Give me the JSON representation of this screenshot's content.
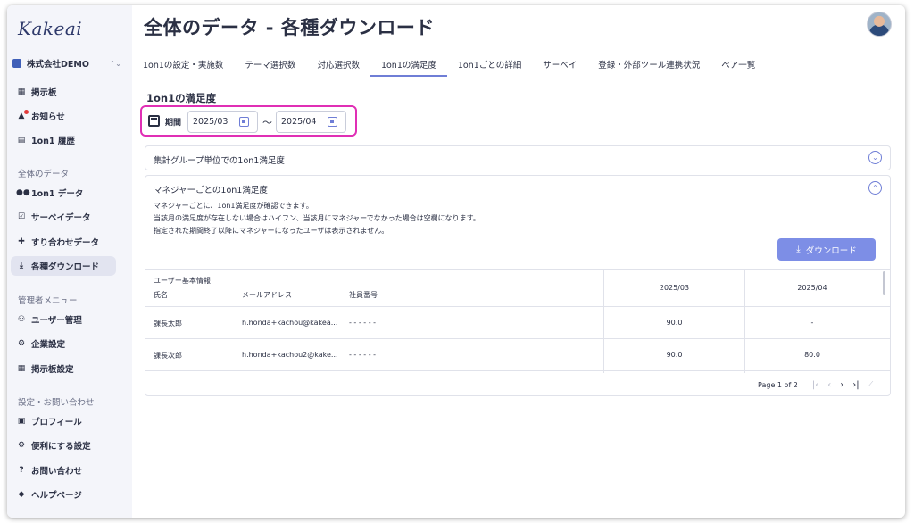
{
  "brand": {
    "logo": "Kakeai"
  },
  "company": {
    "name": "株式会社DEMO",
    "switch_icon": "⌃⌄"
  },
  "sidebar": {
    "top_items": [
      {
        "label": "掲示板",
        "icon": "board-icon"
      },
      {
        "label": "お知らせ",
        "icon": "bell-icon"
      },
      {
        "label": "1on1 履歴",
        "icon": "history-icon"
      }
    ],
    "section_data": "全体のデータ",
    "data_items": [
      {
        "label": "1on1 データ",
        "icon": "people-icon"
      },
      {
        "label": "サーベイデータ",
        "icon": "survey-icon"
      },
      {
        "label": "すり合わせデータ",
        "icon": "puzzle-icon"
      },
      {
        "label": "各種ダウンロード",
        "icon": "download-icon"
      }
    ],
    "section_admin": "管理者メニュー",
    "admin_items": [
      {
        "label": "ユーザー管理",
        "icon": "user-manage-icon"
      },
      {
        "label": "企業設定",
        "icon": "company-settings-icon"
      },
      {
        "label": "掲示板設定",
        "icon": "board-settings-icon"
      }
    ],
    "section_settings": "設定・お問い合わせ",
    "settings_items": [
      {
        "label": "プロフィール",
        "icon": "profile-icon"
      },
      {
        "label": "便利にする設定",
        "icon": "gear-icon"
      },
      {
        "label": "お問い合わせ",
        "icon": "help-icon"
      },
      {
        "label": "ヘルプページ",
        "icon": "graduation-icon"
      }
    ]
  },
  "header": {
    "title": "全体のデータ - 各種ダウンロード"
  },
  "tabs": [
    {
      "label": "1on1の設定・実施数"
    },
    {
      "label": "テーマ選択数"
    },
    {
      "label": "対応選択数"
    },
    {
      "label": "1on1の満足度"
    },
    {
      "label": "1on1ごとの詳細"
    },
    {
      "label": "サーベイ"
    },
    {
      "label": "登録・外部ツール連携状況"
    },
    {
      "label": "ペア一覧"
    }
  ],
  "active_tab": "1on1の満足度",
  "content": {
    "title": "1on1の満足度",
    "period": {
      "label": "期間",
      "from": "2025/03",
      "to": "2025/04",
      "separator": "〜"
    },
    "group_panel": {
      "title": "集計グループ単位での1on1満足度"
    },
    "manager_panel": {
      "title": "マネジャーごとの1on1満足度",
      "desc1": "マネジャーごとに、1on1満足度が確認できます。",
      "desc2": "当該月の満足度が存在しない場合はハイフン、当該月にマネジャーでなかった場合は空欄になります。",
      "desc3": "指定された期間終了以降にマネジャーになったユーザは表示されません。",
      "download_label": "ダウンロード"
    },
    "table": {
      "group_header": "ユーザー基本情報",
      "columns": {
        "name": "氏名",
        "email": "メールアドレス",
        "employee_no": "社員番号",
        "m1": "2025/03",
        "m2": "2025/04"
      },
      "rows": [
        {
          "name": "課長太郎",
          "email": "h.honda+kachou@kakea...",
          "employee_no": "- - - - - -",
          "m1": "90.0",
          "m2": "-"
        },
        {
          "name": "課長次郎",
          "email": "h.honda+kachou2@kake...",
          "employee_no": "- - - - - -",
          "m1": "90.0",
          "m2": "80.0"
        }
      ]
    },
    "pager": {
      "text": "Page 1 of 2",
      "first": "|‹",
      "prev": "‹",
      "next": "›",
      "last": "›|"
    }
  }
}
